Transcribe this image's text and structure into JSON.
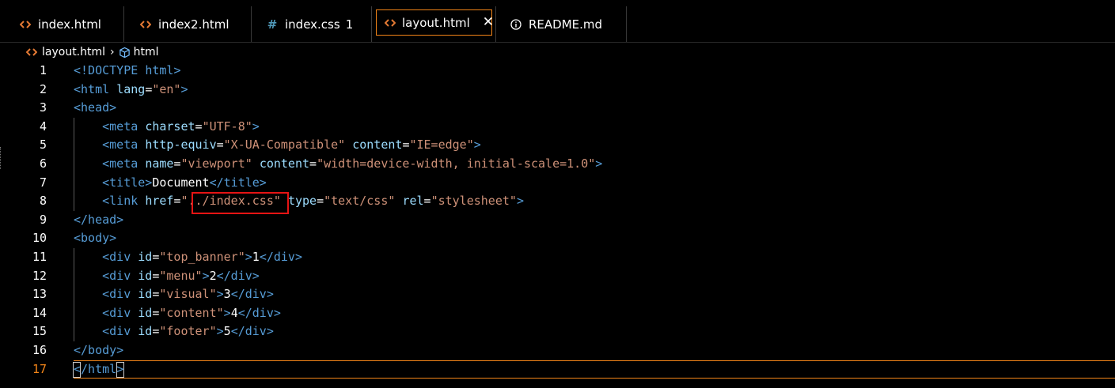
{
  "tabs": [
    {
      "label": "index.html",
      "icon": "html-file-icon"
    },
    {
      "label": "index2.html",
      "icon": "html-file-icon"
    },
    {
      "label": "index.css",
      "count": "1",
      "icon": "css-file-icon"
    },
    {
      "label": "layout.html",
      "icon": "html-file-icon",
      "active": true,
      "close": "✕"
    },
    {
      "label": "README.md",
      "icon": "info-icon"
    }
  ],
  "breadcrumb": {
    "file": "layout.html",
    "sep": "›",
    "node": "html"
  },
  "colors": {
    "accent": "#f38518",
    "tag": "#569cd6",
    "attr": "#9cdcfe",
    "string": "#ce9178",
    "highlight": "#e61414"
  },
  "lines": [
    {
      "n": "1"
    },
    {
      "n": "2"
    },
    {
      "n": "3"
    },
    {
      "n": "4"
    },
    {
      "n": "5"
    },
    {
      "n": "6"
    },
    {
      "n": "7"
    },
    {
      "n": "8"
    },
    {
      "n": "9"
    },
    {
      "n": "10"
    },
    {
      "n": "11"
    },
    {
      "n": "12"
    },
    {
      "n": "13"
    },
    {
      "n": "14"
    },
    {
      "n": "15"
    },
    {
      "n": "16"
    },
    {
      "n": "17"
    }
  ],
  "code": {
    "l1": {
      "open": "<!DOCTYPE",
      "kw": "html",
      "close": ">"
    },
    "l2": {
      "open": "<html",
      "attr": "lang",
      "eq": "=",
      "val": "\"en\"",
      "close": ">"
    },
    "l3": {
      "tag": "<head>"
    },
    "l4": {
      "open": "<meta",
      "attr": "charset",
      "eq": "=",
      "val": "\"UTF-8\"",
      "close": ">"
    },
    "l5": {
      "open": "<meta",
      "attr1": "http-equiv",
      "eq": "=",
      "val1": "\"X-UA-Compatible\"",
      "attr2": "content",
      "val2": "\"IE=edge\"",
      "close": ">"
    },
    "l6": {
      "open": "<meta",
      "attr1": "name",
      "eq": "=",
      "val1": "\"viewport\"",
      "attr2": "content",
      "val2": "\"width=device-width, initial-scale=1.0\"",
      "close": ">"
    },
    "l7": {
      "open": "<title>",
      "text": "Document",
      "close": "</title>"
    },
    "l8": {
      "open": "<link",
      "attr1": "href",
      "eq": "=",
      "q": "\"",
      "val1": "../index.css",
      "q2": "\"",
      "attr2": "type",
      "val2": "\"text/css\"",
      "attr3": "rel",
      "val3": "\"stylesheet\"",
      "close": ">"
    },
    "l9": {
      "tag": "</head>"
    },
    "l10": {
      "tag": "<body>"
    },
    "l11": {
      "open": "<div",
      "attr": "id",
      "eq": "=",
      "val": "\"top_banner\"",
      "gt": ">",
      "text": "1",
      "close": "</div>"
    },
    "l12": {
      "open": "<div",
      "attr": "id",
      "eq": "=",
      "val": "\"menu\"",
      "gt": ">",
      "text": "2",
      "close": "</div>"
    },
    "l13": {
      "open": "<div",
      "attr": "id",
      "eq": "=",
      "val": "\"visual\"",
      "gt": ">",
      "text": "3",
      "close": "</div>"
    },
    "l14": {
      "open": "<div",
      "attr": "id",
      "eq": "=",
      "val": "\"content\"",
      "gt": ">",
      "text": "4",
      "close": "</div>"
    },
    "l15": {
      "open": "<div",
      "attr": "id",
      "eq": "=",
      "val": "\"footer\"",
      "gt": ">",
      "text": "5",
      "close": "</div>"
    },
    "l16": {
      "tag": "</body>"
    },
    "l17": {
      "lt": "<",
      "rest": "/html",
      "gt": ">"
    }
  }
}
